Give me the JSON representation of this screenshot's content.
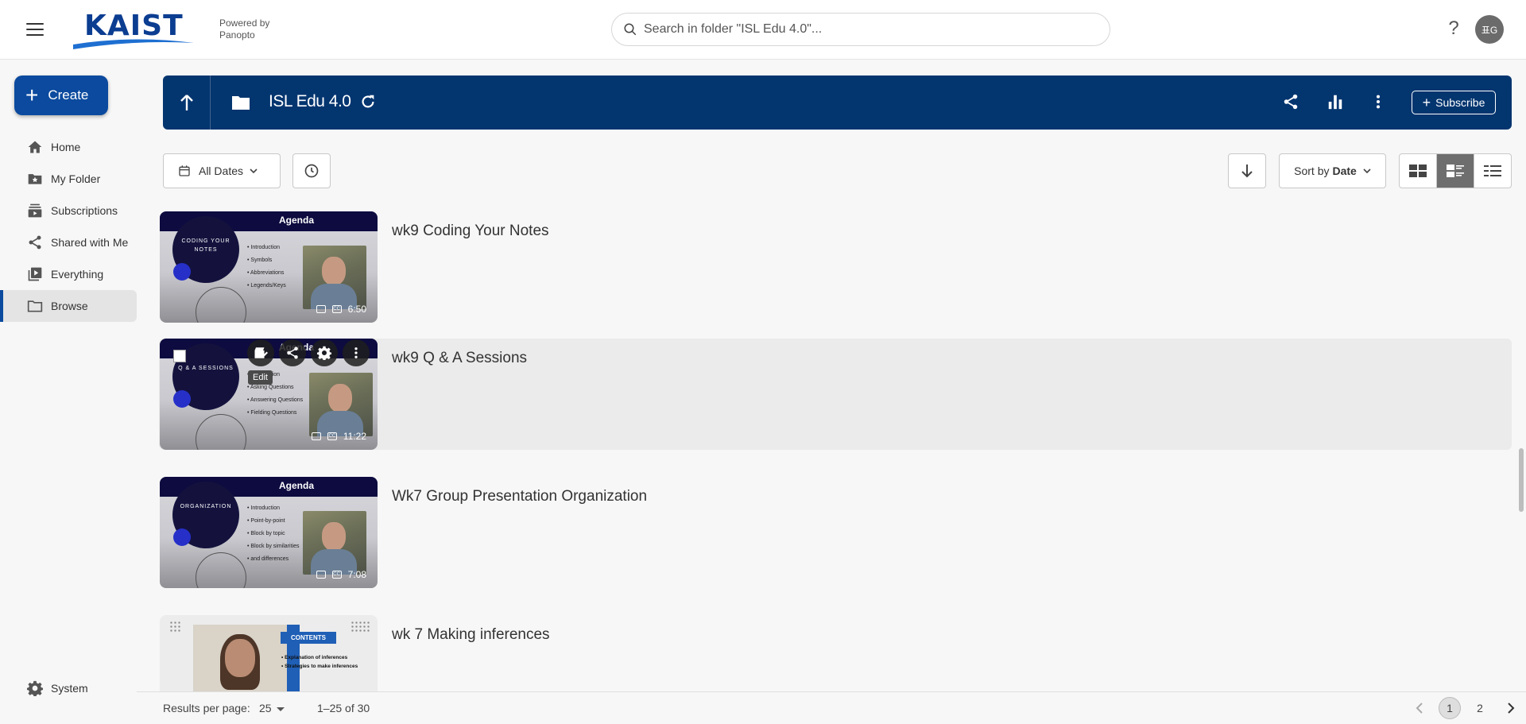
{
  "header": {
    "logo_text": "KAIST",
    "powered_line1": "Powered by",
    "powered_line2": "Panopto",
    "search_placeholder": "Search in folder \"ISL Edu 4.0\"...",
    "help_label": "?",
    "avatar_initials": "표G"
  },
  "sidebar": {
    "create_label": "Create",
    "items": [
      {
        "label": "Home",
        "icon": "home-icon"
      },
      {
        "label": "My Folder",
        "icon": "folder-star-icon"
      },
      {
        "label": "Subscriptions",
        "icon": "subscriptions-icon"
      },
      {
        "label": "Shared with Me",
        "icon": "share-icon"
      },
      {
        "label": "Everything",
        "icon": "library-icon"
      },
      {
        "label": "Browse",
        "icon": "folder-icon",
        "active": true
      }
    ],
    "system_label": "System"
  },
  "folder": {
    "title": "ISL Edu 4.0",
    "subscribe_label": "Subscribe",
    "brand_color": "#03356f"
  },
  "filters": {
    "date_label": "All Dates",
    "sort_prefix": "Sort by",
    "sort_value": "Date"
  },
  "sessions": [
    {
      "title": "wk9 Coding Your Notes",
      "duration": "6:50",
      "thumb_heading": "Agenda",
      "thumb_circle": "CODING YOUR NOTES",
      "thumb_bullets": [
        "Introduction",
        "Symbols",
        "Abbreviations",
        "Legends/Keys"
      ]
    },
    {
      "title": "wk9 Q & A Sessions",
      "duration": "11:22",
      "thumb_heading": "Agenda",
      "thumb_circle": "Q & A SESSIONS",
      "thumb_bullets": [
        "Introduction",
        "Asking Questions",
        "Answering Questions",
        "Fielding Questions"
      ],
      "tooltip": "Edit"
    },
    {
      "title": "Wk7 Group Presentation Organization",
      "duration": "7:08",
      "thumb_heading": "Agenda",
      "thumb_circle": "ORGANIZATION",
      "thumb_bullets": [
        "Introduction",
        "Point-by-point",
        "Block by topic",
        "Block by similarities",
        "and differences"
      ]
    },
    {
      "title": "wk 7 Making inferences",
      "thumb_heading": "CONTENTS",
      "thumb_bullets": [
        "Explanation of inferences",
        "Strategies to make inferences"
      ]
    }
  ],
  "pager": {
    "rpp_label": "Results per page:",
    "rpp_value": "25",
    "range": "1–25 of 30",
    "pages": [
      "1",
      "2"
    ],
    "current": "1"
  }
}
